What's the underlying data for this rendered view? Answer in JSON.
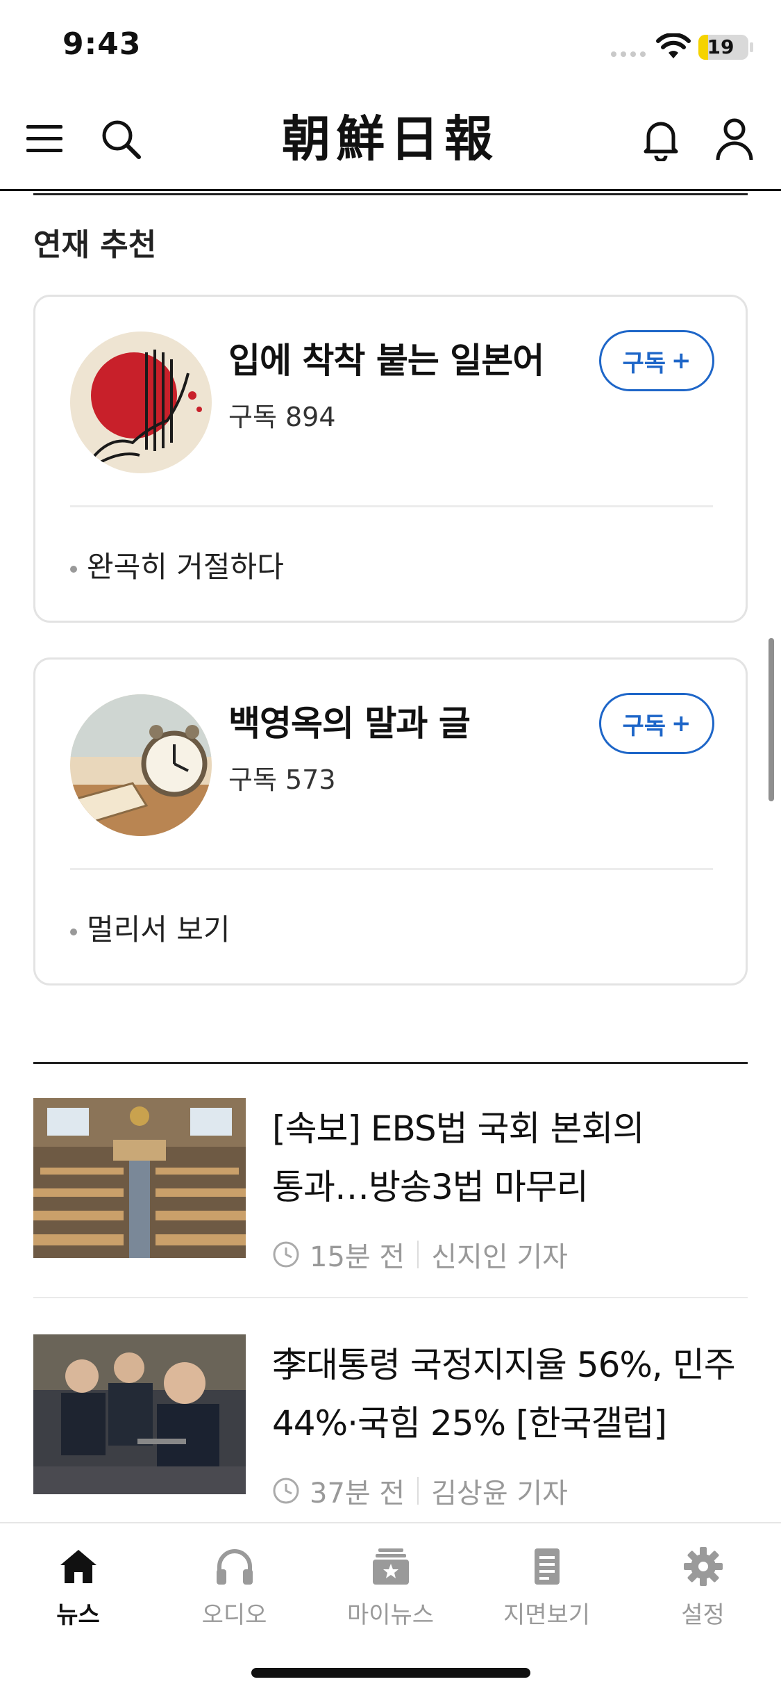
{
  "status_bar": {
    "time": "9:43",
    "battery": "19",
    "battery_level": 0.19,
    "battery_color": "#f5d300",
    "icons": [
      "signal-icon",
      "wifi-icon",
      "battery-icon"
    ]
  },
  "header": {
    "logo": "朝鮮日報",
    "icons": [
      "menu-icon",
      "search-icon",
      "bell-icon",
      "profile-icon"
    ]
  },
  "section": {
    "title": "연재 추천"
  },
  "series": [
    {
      "title": "입에 착착 붙는 일본어",
      "subscribers": "구독 894",
      "subscribe_label": "구독",
      "subscribe_icon": "+",
      "latest": "완곡히 거절하다"
    },
    {
      "title": "백영옥의 말과 글",
      "subscribers": "구독 573",
      "subscribe_label": "구독",
      "subscribe_icon": "+",
      "latest": "멀리서 보기"
    }
  ],
  "articles": [
    {
      "title_line1": "[속보] EBS법 국회 본회의",
      "title_line2": "통과…방송3법 마무리",
      "time": "15분 전",
      "author": "신지인 기자"
    },
    {
      "title_line1": "李대통령 국정지지율 56%, 민주",
      "title_line2": "44%·국힘 25% [한국갤럽]",
      "time": "37분 전",
      "author": "김상윤 기자"
    }
  ],
  "tab_bar": {
    "tabs": [
      {
        "label": "뉴스",
        "icon": "home-icon",
        "active": true
      },
      {
        "label": "오디오",
        "icon": "headphones-icon",
        "active": false
      },
      {
        "label": "마이뉴스",
        "icon": "mynews-icon",
        "active": false
      },
      {
        "label": "지면보기",
        "icon": "newspaper-icon",
        "active": false
      },
      {
        "label": "설정",
        "icon": "gear-icon",
        "active": false
      }
    ]
  },
  "colors": {
    "accent": "#1e66c8",
    "text": "#111111",
    "muted": "#999999"
  }
}
